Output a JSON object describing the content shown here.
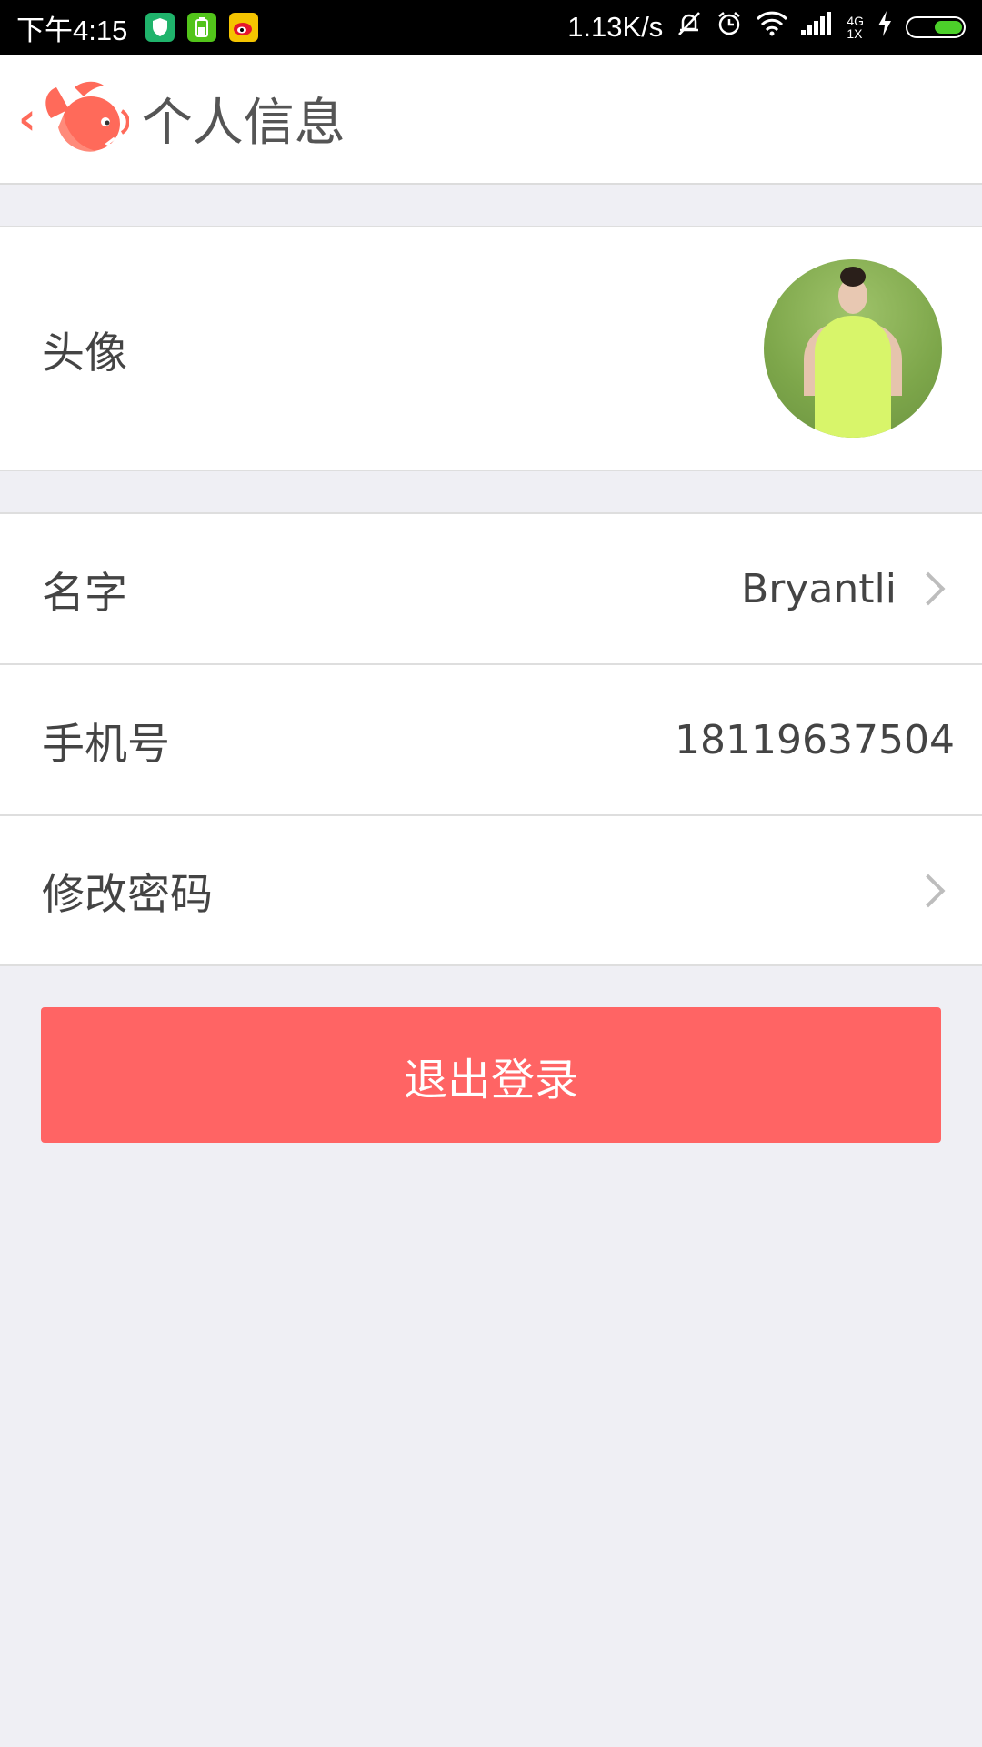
{
  "status_bar": {
    "time": "下午4:15",
    "network_speed": "1.13K/s",
    "network_type_top": "4G",
    "network_type_bottom": "1X"
  },
  "header": {
    "title": "个人信息"
  },
  "rows": {
    "avatar_label": "头像",
    "name_label": "名字",
    "name_value": "Bryantli",
    "phone_label": "手机号",
    "phone_value": "18119637504",
    "password_label": "修改密码"
  },
  "logout_button": "退出登录",
  "colors": {
    "accent": "#ff6464",
    "logo": "#ff6a5a",
    "background": "#efeff4"
  },
  "icons": [
    "shield-app-icon",
    "battery-app-icon",
    "weibo-app-icon",
    "bell-muted-icon",
    "alarm-icon",
    "wifi-icon",
    "signal-icon",
    "charging-icon",
    "battery-icon",
    "back-chevron-icon",
    "fish-logo-icon",
    "chevron-right-icon"
  ]
}
